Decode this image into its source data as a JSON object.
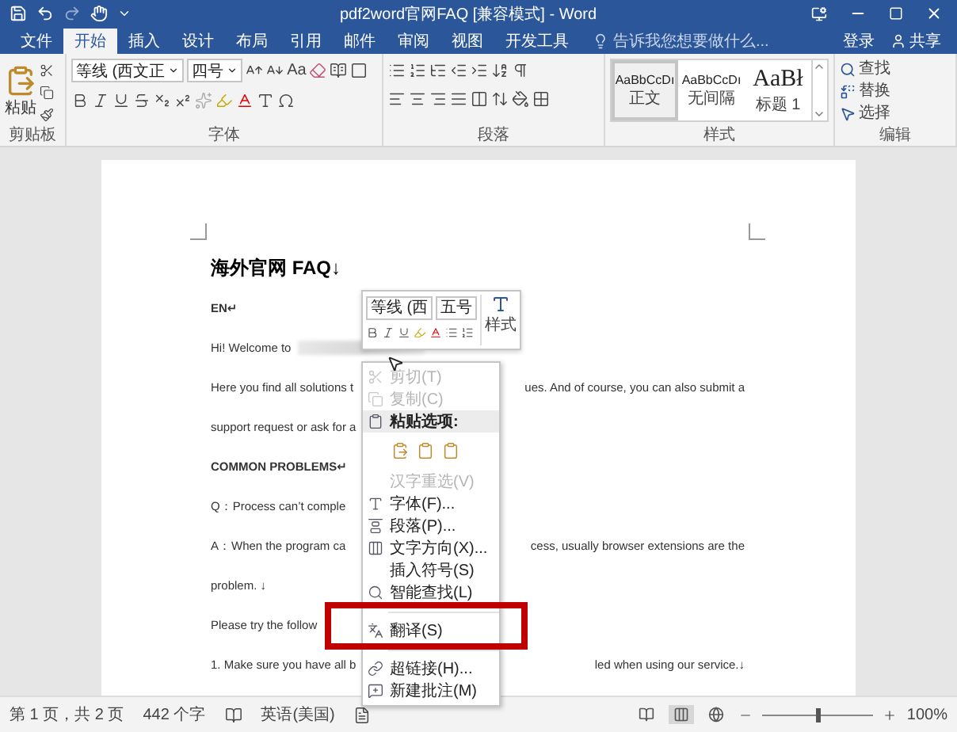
{
  "window": {
    "title": "pdf2word官网FAQ [兼容模式] - Word"
  },
  "tabs": [
    {
      "label": "文件",
      "selected": false
    },
    {
      "label": "开始",
      "selected": true
    },
    {
      "label": "插入",
      "selected": false
    },
    {
      "label": "设计",
      "selected": false
    },
    {
      "label": "布局",
      "selected": false
    },
    {
      "label": "引用",
      "selected": false
    },
    {
      "label": "邮件",
      "selected": false
    },
    {
      "label": "审阅",
      "selected": false
    },
    {
      "label": "视图",
      "selected": false
    },
    {
      "label": "开发工具",
      "selected": false
    }
  ],
  "tell_me": {
    "placeholder": "告诉我您想要做什么..."
  },
  "sign_in": "登录",
  "share": "共享",
  "ribbon": {
    "clipboard": {
      "label": "剪贴板",
      "paste": "粘贴"
    },
    "font": {
      "label": "字体",
      "font_name": "等线 (西文正",
      "font_size": "四号",
      "change_case": "Aa"
    },
    "paragraph": {
      "label": "段落"
    },
    "styles": {
      "label": "样式",
      "items": [
        {
          "preview": "AaBbCcDı",
          "name": "正文",
          "kind": "body",
          "selected": true
        },
        {
          "preview": "AaBbCcDı",
          "name": "无间隔",
          "kind": "body",
          "selected": false
        },
        {
          "preview": "AaBł",
          "name": "标题 1",
          "kind": "heading",
          "selected": false
        }
      ]
    },
    "editing": {
      "label": "编辑",
      "items": [
        "查找",
        "替换",
        "选择"
      ]
    }
  },
  "document": {
    "lines": [
      {
        "kind": "heading",
        "left": "海外官网 FAQ↓"
      },
      {
        "kind": "bold",
        "left": "EN↵"
      },
      {
        "kind": "blurred",
        "left": "Hi! Welcome to"
      },
      {
        "kind": "text",
        "left": "Here you find all solutions t",
        "right": "ues. And of course, you can also submit a"
      },
      {
        "kind": "text",
        "left": "support request or ask for a"
      },
      {
        "kind": "bold",
        "left": "COMMON PROBLEMS↵"
      },
      {
        "kind": "text",
        "left": "Q：Process can’t comple"
      },
      {
        "kind": "text",
        "left": "A：When the program ca",
        "right": "cess, usually browser extensions are the"
      },
      {
        "kind": "text",
        "left": "problem. ↓"
      },
      {
        "kind": "text",
        "left": "Please try the follow"
      },
      {
        "kind": "text",
        "left": "1. Make sure you have all b",
        "right": "led when using our service.↓"
      }
    ]
  },
  "mini_toolbar": {
    "font_name": "等线 (西",
    "font_size": "五号",
    "styles": "样式"
  },
  "context_menu": {
    "items": [
      {
        "kind": "cut",
        "label": "剪切(T)",
        "disabled": true
      },
      {
        "kind": "copy",
        "label": "复制(C)",
        "disabled": true
      },
      {
        "kind": "header",
        "label": "粘贴选项:"
      },
      {
        "kind": "paste"
      },
      {
        "kind": "plain",
        "label": "汉字重选(V)",
        "disabled": true
      },
      {
        "kind": "font",
        "label": "字体(F)...",
        "disabled": false
      },
      {
        "kind": "paragraph",
        "label": "段落(P)...",
        "disabled": false
      },
      {
        "kind": "direction",
        "label": "文字方向(X)...",
        "disabled": false
      },
      {
        "kind": "plain",
        "label": "插入符号(S)",
        "disabled": false
      },
      {
        "kind": "lookup",
        "label": "智能查找(L)",
        "disabled": false
      },
      {
        "kind": "separator"
      },
      {
        "kind": "translate",
        "label": "翻译(S)",
        "disabled": false
      },
      {
        "kind": "separator"
      },
      {
        "kind": "link",
        "label": "超链接(H)...",
        "disabled": false
      },
      {
        "kind": "comment",
        "label": "新建批注(M)",
        "disabled": false
      }
    ]
  },
  "status_bar": {
    "page": "第 1 页，共 2 页",
    "words": "442 个字",
    "language": "英语(美国)",
    "zoom": {
      "level": 0.5
    },
    "zoom_text": "100%"
  }
}
